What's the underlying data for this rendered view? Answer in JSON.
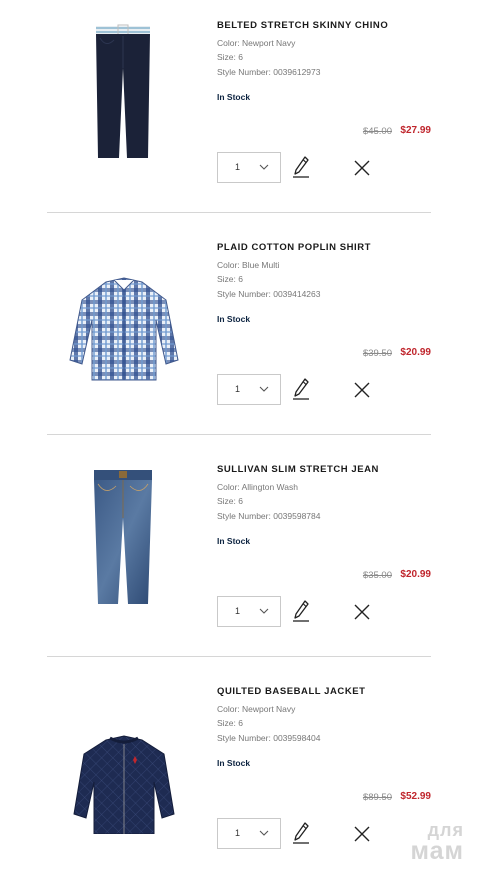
{
  "items": [
    {
      "name": "BELTED STRETCH SKINNY CHINO",
      "color": "Color: Newport Navy",
      "size": "Size: 6",
      "style": "Style Number: 0039612973",
      "stock": "In Stock",
      "old_price": "$45.00",
      "price": "$27.99",
      "quantity": "1",
      "image_icon": "navy-chino-pants-image"
    },
    {
      "name": "PLAID COTTON POPLIN SHIRT",
      "color": "Color: Blue Multi",
      "size": "Size: 6",
      "style": "Style Number: 0039414263",
      "stock": "In Stock",
      "old_price": "$39.50",
      "price": "$20.99",
      "quantity": "1",
      "image_icon": "plaid-shirt-image"
    },
    {
      "name": "SULLIVAN SLIM STRETCH JEAN",
      "color": "Color: Allington Wash",
      "size": "Size: 6",
      "style": "Style Number: 0039598784",
      "stock": "In Stock",
      "old_price": "$35.00",
      "price": "$20.99",
      "quantity": "1",
      "image_icon": "denim-jeans-image"
    },
    {
      "name": "QUILTED BASEBALL JACKET",
      "color": "Color: Newport Navy",
      "size": "Size: 6",
      "style": "Style Number: 0039598404",
      "stock": "In Stock",
      "old_price": "$89.50",
      "price": "$52.99",
      "quantity": "1",
      "image_icon": "quilted-jacket-image"
    }
  ],
  "icons": {
    "quantity_dropdown": "chevron-down-icon",
    "edit": "pencil-icon",
    "remove": "close-icon"
  },
  "colors": {
    "sale_price": "#c0262d",
    "stock_text": "#0c2340",
    "original_price": "#8a8a8a"
  },
  "watermark": {
    "line1": "для",
    "line2": "мам"
  }
}
